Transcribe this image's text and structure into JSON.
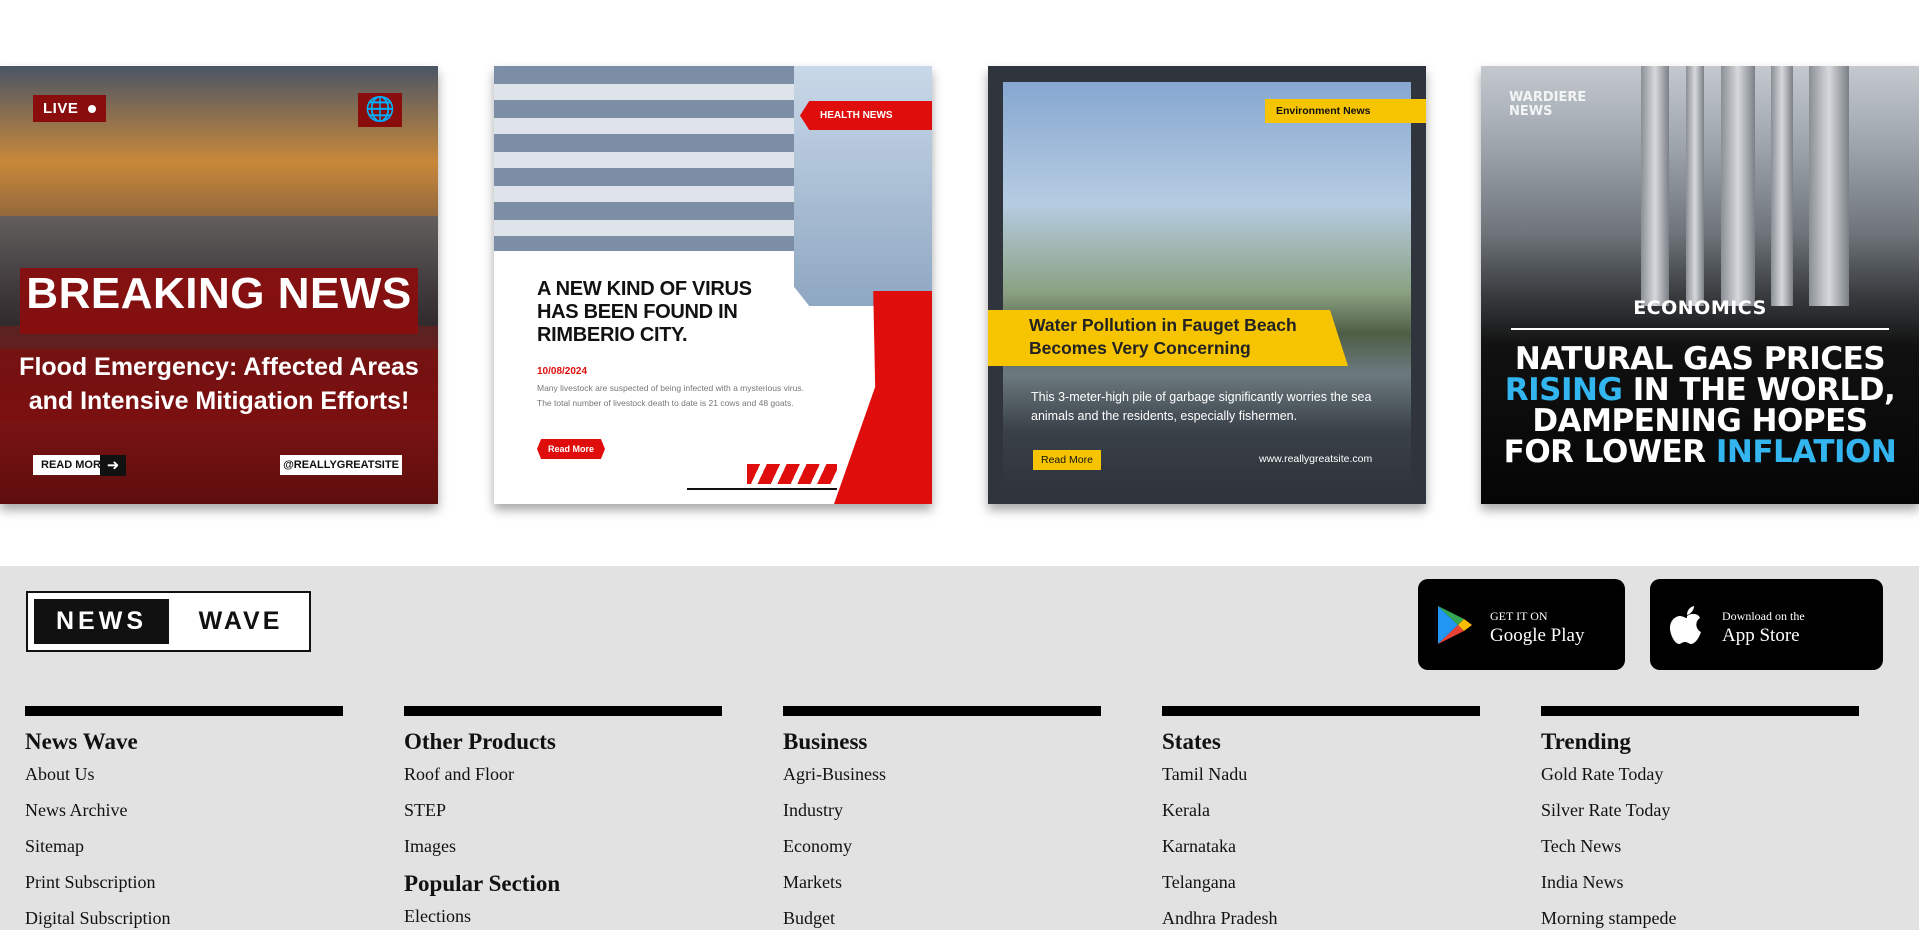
{
  "cards": {
    "breaking": {
      "live": "LIVE",
      "title": "BREAKING NEWS",
      "subtitle_line1": "Flood Emergency: Affected Areas",
      "subtitle_line2": "and Intensive Mitigation Efforts!",
      "read_more": "READ MORE",
      "handle": "@REALLYGREATSITE"
    },
    "health": {
      "tag": "HEALTH NEWS",
      "headline": "A NEW KIND OF VIRUS HAS BEEN FOUND IN RIMBERIO CITY.",
      "date": "10/08/2024",
      "body": "Many livestock are suspected of being infected with a mysterious virus. The total number of livestock death to date is 21 cows and 48 goats.",
      "read_more": "Read More"
    },
    "environment": {
      "tag": "Environment News",
      "title": "Water Pollution in Fauget Beach Becomes Very Concerning",
      "desc": "This 3-meter-high pile of garbage significantly worries the sea animals and the residents, especially fishermen.",
      "read_more": "Read More",
      "url": "www.reallygreatsite.com"
    },
    "economics": {
      "brand_line1": "WARDIERE",
      "brand_line2": "NEWS",
      "section": "ECONOMICS",
      "line1": "NATURAL GAS PRICES",
      "line2_blue": "RISING",
      "line2_rest": " IN THE WORLD,",
      "line3": "DAMPENING HOPES",
      "line4_rest": "FOR LOWER ",
      "line4_blue": "INFLATION"
    }
  },
  "footer": {
    "logo": {
      "left": "NEWS",
      "right": "WAVE"
    },
    "google_play": {
      "small": "GET IT ON",
      "big": "Google Play"
    },
    "app_store": {
      "small": "Download on the",
      "big": "App Store"
    },
    "columns": [
      {
        "title": "News Wave",
        "links": [
          "About Us",
          "News Archive",
          "Sitemap",
          "Print Subscription",
          "Digital Subscription"
        ]
      },
      {
        "title": "Other Products",
        "links": [
          "Roof and Floor",
          "STEP",
          "Images"
        ],
        "title2": "Popular Section",
        "links2": [
          "Elections"
        ]
      },
      {
        "title": "Business",
        "links": [
          "Agri-Business",
          "Industry",
          "Economy",
          "Markets",
          "Budget"
        ]
      },
      {
        "title": "States",
        "links": [
          "Tamil Nadu",
          "Kerala",
          "Karnataka",
          "Telangana",
          "Andhra Pradesh"
        ]
      },
      {
        "title": "Trending",
        "links": [
          "Gold Rate Today",
          "Silver Rate Today",
          "Tech News",
          "India News",
          "Morning stampede"
        ]
      }
    ]
  }
}
